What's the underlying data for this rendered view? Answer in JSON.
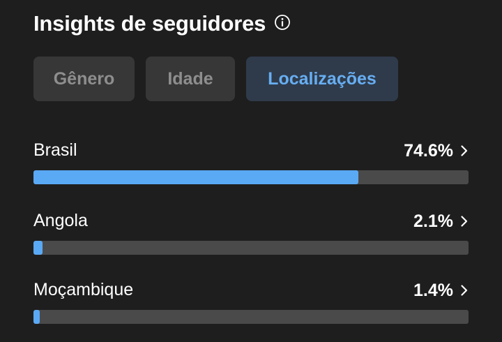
{
  "header": {
    "title": "Insights de seguidores",
    "info_icon": "info-icon"
  },
  "tabs": [
    {
      "label": "Gênero",
      "active": false
    },
    {
      "label": "Idade",
      "active": false
    },
    {
      "label": "Localizações",
      "active": true
    }
  ],
  "locations": [
    {
      "name": "Brasil",
      "value": "74.6%",
      "fraction": 0.746
    },
    {
      "name": "Angola",
      "value": "2.1%",
      "fraction": 0.021
    },
    {
      "name": "Moçambique",
      "value": "1.4%",
      "fraction": 0.014
    }
  ],
  "colors": {
    "background": "#1e1e1e",
    "bar_fill": "#5aa9f5",
    "bar_track": "#4a4a4a",
    "active_tab_bg": "#2f3b4b",
    "active_tab_text": "#67aef2",
    "inactive_tab_bg": "#373737",
    "inactive_tab_text": "#8e8e8e"
  }
}
